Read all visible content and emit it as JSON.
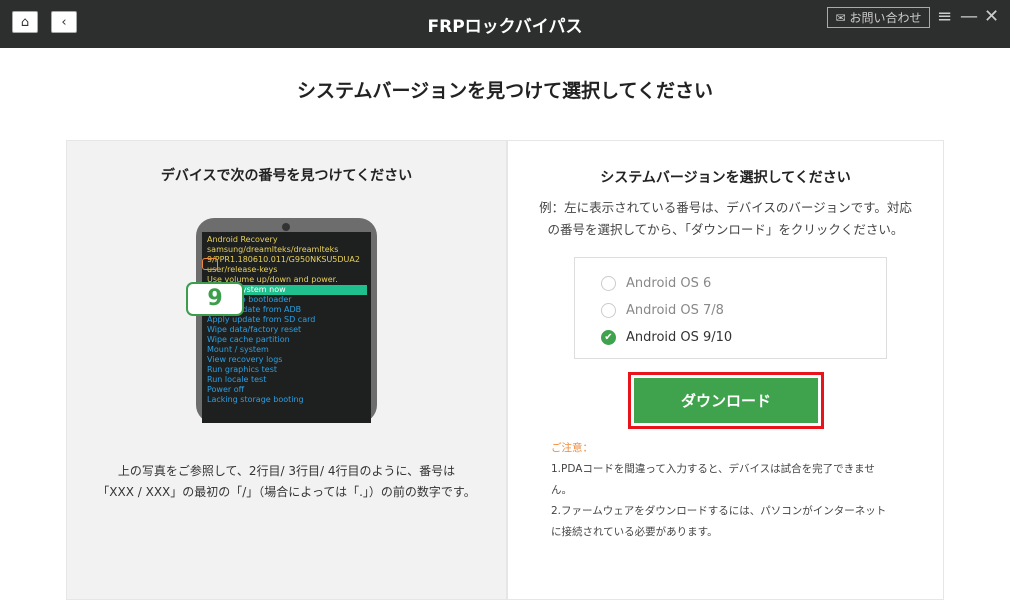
{
  "header": {
    "title": "FRPロックバイパス",
    "contact_label": "お問い合わせ"
  },
  "main_title": "システムバージョンを見つけて選択してください",
  "left": {
    "title": "デバイスで次の番号を見つけてください",
    "phone_lines_yellow": [
      "Android Recovery",
      "samsung/dreamlteks/dreamlteks",
      "9/PPR1.180610.011/G950NKSU5DUA2",
      "user/release-keys",
      "Use volume up/down and power."
    ],
    "phone_highlight": "Reboot system now",
    "phone_lines_blue": [
      "Reboot to bootloader",
      "Apply update from ADB",
      "Apply update from SD card",
      "Wipe data/factory reset",
      "Wipe cache partition",
      "Mount / system",
      "View recovery logs",
      "Run graphics test",
      "Run locale test",
      "Power off",
      "Lacking storage booting"
    ],
    "badge": "9",
    "desc1": "上の写真をご参照して、2行目/ 3行目/ 4行目のように、番号は",
    "desc2": "「XXX / XXX」の最初の「/」（場合によっては「.」）の前の数字です。"
  },
  "right": {
    "title": "システムバージョンを選択してください",
    "desc1": "例：左に表示されている番号は、デバイスのバージョンです。対応",
    "desc2": "の番号を選択してから、「ダウンロード」をクリックください。",
    "options": [
      {
        "label": "Android OS 6",
        "selected": false
      },
      {
        "label": "Android OS 7/8",
        "selected": false
      },
      {
        "label": "Android OS 9/10",
        "selected": true
      }
    ],
    "download_label": "ダウンロード",
    "notes_title": "ご注意：",
    "note1": "1.PDAコードを間違って入力すると、デバイスは試合を完了できません。",
    "note2": "2.ファームウェアをダウンロードするには、パソコンがインターネットに接続されている必要があります。"
  }
}
